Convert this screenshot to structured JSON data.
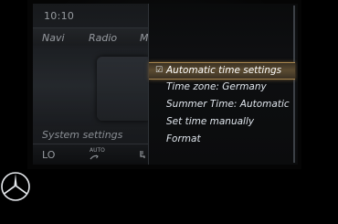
{
  "status": {
    "clock": "10:10"
  },
  "topnav": {
    "items": [
      "Navi",
      "Radio",
      "M"
    ]
  },
  "main": {
    "section_title": "System settings"
  },
  "bottombar": {
    "temp_left": "LO",
    "climate_mode": "AUTO",
    "fan_icon": "fan-icon",
    "seat_icon": "seat-heat-icon"
  },
  "menu": {
    "items": [
      {
        "label": "Automatic time settings",
        "checked": true,
        "selected": true
      },
      {
        "label": "Time zone: Germany",
        "checked": false,
        "selected": false
      },
      {
        "label": "Summer Time: Automatic",
        "checked": false,
        "selected": false
      },
      {
        "label": "Set time manually",
        "checked": false,
        "selected": false
      },
      {
        "label": "Format",
        "checked": false,
        "selected": false
      }
    ],
    "check_glyph": "☑"
  },
  "brand": {
    "logo": "mercedes-star-logo"
  },
  "colors": {
    "selection": "#5b4b31",
    "selection_border": "#a8864f",
    "text": "#dfe5ec"
  }
}
